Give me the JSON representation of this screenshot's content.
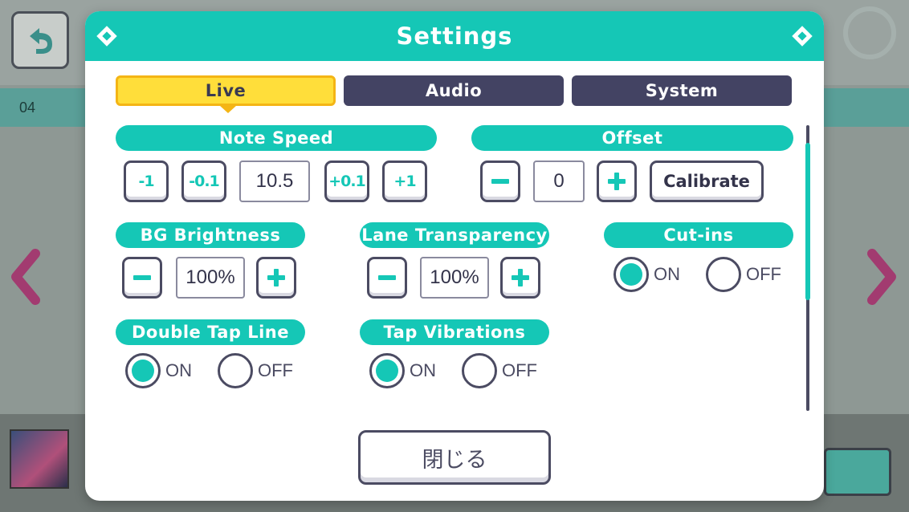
{
  "background": {
    "strip_number": "04"
  },
  "dialog": {
    "title": "Settings",
    "tabs": [
      {
        "label": "Live",
        "active": true
      },
      {
        "label": "Audio",
        "active": false
      },
      {
        "label": "System",
        "active": false
      }
    ],
    "note_speed": {
      "label": "Note Speed",
      "buttons": [
        "-1",
        "-0.1",
        "+0.1",
        "+1"
      ],
      "value": "10.5"
    },
    "offset": {
      "label": "Offset",
      "value": "0",
      "calibrate_label": "Calibrate"
    },
    "bg_brightness": {
      "label": "BG Brightness",
      "value": "100%"
    },
    "lane_transparency": {
      "label": "Lane Transparency",
      "value": "100%"
    },
    "cut_ins": {
      "label": "Cut-ins",
      "on_label": "ON",
      "off_label": "OFF",
      "selected": "ON"
    },
    "double_tap_line": {
      "label": "Double Tap Line",
      "on_label": "ON",
      "off_label": "OFF",
      "selected": "ON"
    },
    "tap_vibrations": {
      "label": "Tap Vibrations",
      "on_label": "ON",
      "off_label": "OFF",
      "selected": "ON"
    },
    "close_label": "閉じる"
  },
  "colors": {
    "accent": "#15c7b6",
    "tab_active": "#ffde3a",
    "tab_inactive": "#434363",
    "outline": "#4b4b62"
  }
}
